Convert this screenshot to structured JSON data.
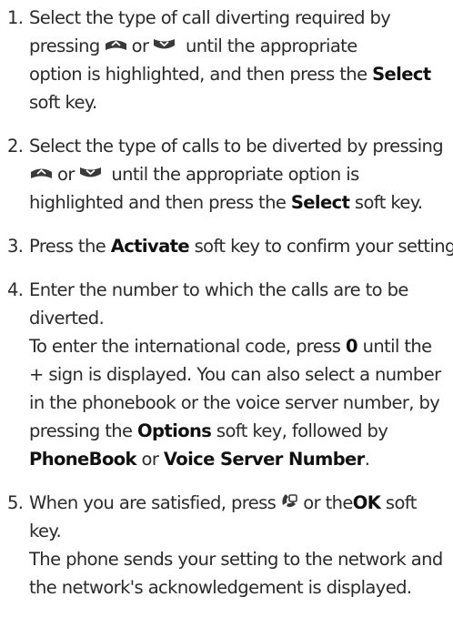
{
  "steps": [
    {
      "number": "1.",
      "l1": "Select the type of call diverting required by",
      "l2a": "pressing",
      "l2b": "or",
      "l2c": "until the appropriate",
      "l3": "option is highlighted, and then press the",
      "l3b": "Select",
      "l4": "soft key."
    },
    {
      "number": "2.",
      "l1": "Select the type of calls to be diverted by pressing",
      "l2a": "or",
      "l2b": "until the appropriate option is",
      "l3a": "highlighted and then press the",
      "l3b": "Select",
      "l3c": "soft key."
    },
    {
      "number": "3.",
      "l1a": "Press the",
      "l1b": "Activate",
      "l1c": "soft key to confirm your settings."
    },
    {
      "number": "4.",
      "l1": "Enter the number to which the calls are to be",
      "l2": "diverted.",
      "l3a": "To enter the international code, press",
      "l3b": "0",
      "l3c": "until the",
      "l4": "+ sign is displayed. You can also select a number",
      "l5": "in the phonebook or the voice server number, by",
      "l6a": "pressing the",
      "l6b": "Options",
      "l6c": "soft key, followed by",
      "l7a": "PhoneBook",
      "l7b": "or",
      "l7c": "Voice Server Number",
      "l7d": "."
    },
    {
      "number": "5.",
      "l1a": "When you are satisfied, press",
      "l1b": "or the",
      "l1c": "OK",
      "l1d": "soft",
      "l2": "key.",
      "l3": "The phone sends your setting to the network and",
      "l4": "the network's acknowledgement is displayed."
    }
  ],
  "icons": {
    "up_key": "up-navigation-key-icon",
    "down_key": "down-navigation-key-icon",
    "send_key": "send-key-icon"
  },
  "colors": {
    "text": "#2a2a2a"
  }
}
